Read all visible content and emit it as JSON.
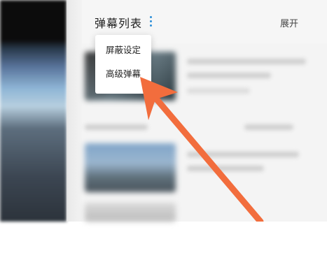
{
  "panel": {
    "title": "弹幕列表",
    "expand_label": "展开"
  },
  "menu": {
    "items": [
      {
        "label": "屏蔽设定"
      },
      {
        "label": "高级弹幕"
      }
    ]
  },
  "icons": {
    "more": "more-vertical-icon",
    "annotation": "arrow-annotation-icon"
  },
  "colors": {
    "accent": "#2d8fd8",
    "annotation_arrow": "#f26d3d"
  }
}
